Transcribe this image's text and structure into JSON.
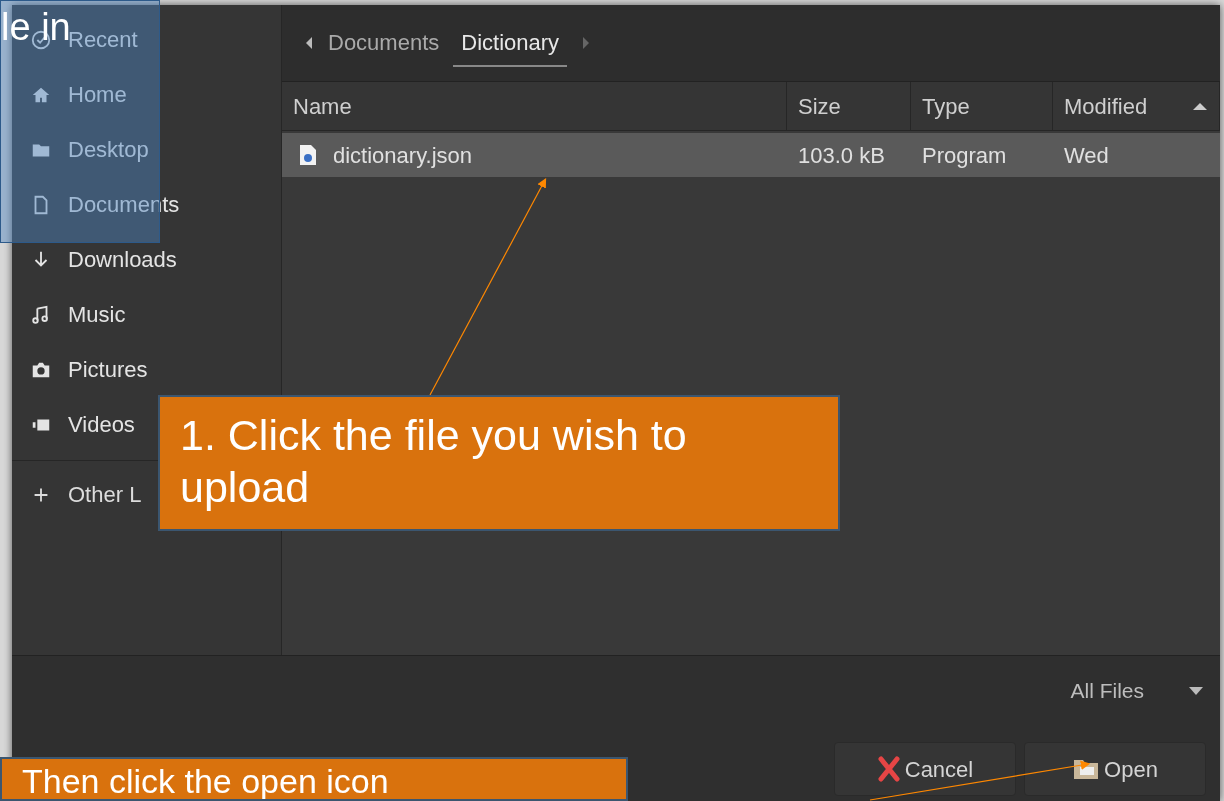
{
  "sidebar": {
    "items": [
      {
        "label": "Recent"
      },
      {
        "label": "Home"
      },
      {
        "label": "Desktop"
      },
      {
        "label": "Documents"
      },
      {
        "label": "Downloads"
      },
      {
        "label": "Music"
      },
      {
        "label": "Pictures"
      },
      {
        "label": "Videos"
      }
    ],
    "other": {
      "label": "Other L"
    }
  },
  "path_bar": {
    "segments": [
      {
        "label": "Documents",
        "selected": false
      },
      {
        "label": "Dictionary",
        "selected": true
      }
    ]
  },
  "table": {
    "columns": [
      {
        "label": "Name",
        "sorted": false
      },
      {
        "label": "Size",
        "sorted": false
      },
      {
        "label": "Type",
        "sorted": false
      },
      {
        "label": "Modified",
        "sorted": true
      }
    ],
    "rows": [
      {
        "cells": [
          "dictionary.json",
          "103.0 kB",
          "Program",
          "Wed"
        ],
        "selected": true
      }
    ]
  },
  "filter": {
    "value": "All Files"
  },
  "buttons": [
    {
      "label": "Cancel"
    },
    {
      "label": "Open"
    }
  ],
  "callouts": [
    {
      "kind": "note",
      "text": "le in"
    },
    {
      "kind": "step",
      "text": "1. Click the file you wish to upload"
    },
    {
      "kind": "step",
      "text": "Then click the open icon"
    }
  ]
}
